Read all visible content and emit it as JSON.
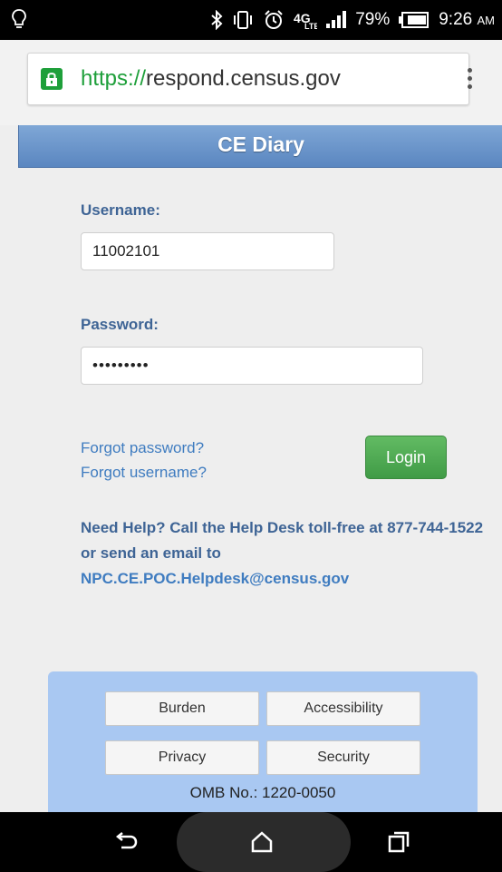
{
  "status_bar": {
    "battery": "79%",
    "time": "9:26",
    "ampm": "AM",
    "network": "4G LTE",
    "icons": [
      "lightbulb-icon",
      "bluetooth-icon",
      "vibrate-icon",
      "alarm-icon",
      "network-4g-icon",
      "signal-icon",
      "battery-icon"
    ]
  },
  "browser": {
    "url_scheme": "https://",
    "url_host": "respond.census.gov",
    "accent": "#1e9f3a"
  },
  "page": {
    "title": "CE Diary",
    "username_label": "Username:",
    "username_value": "11002101",
    "password_label": "Password:",
    "password_value": "•••••••••",
    "forgot_password": "Forgot password?",
    "forgot_username": "Forgot username?",
    "login_label": "Login",
    "help_text": "Need Help? Call the Help Desk toll-free at 877-744-1522 or send an email to",
    "help_email": "NPC.CE.POC.Helpdesk@census.gov"
  },
  "footer": {
    "buttons": [
      "Burden",
      "Accessibility",
      "Privacy",
      "Security"
    ],
    "omb": "OMB No.: 1220-0050"
  },
  "colors": {
    "header": "#6a93c8",
    "login": "#4cab50",
    "footer_bg": "#a9c8f2",
    "label": "#3e6495",
    "link": "#3f7cc0"
  }
}
